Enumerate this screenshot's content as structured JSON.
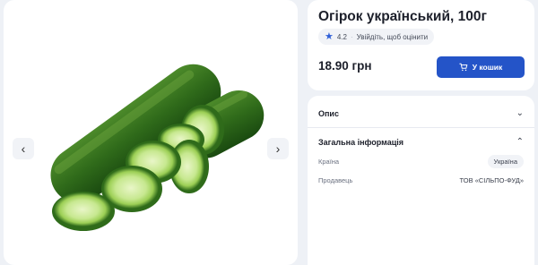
{
  "product": {
    "title": "Огірок український, 100г",
    "rating": "4.2",
    "rate_prompt": "Увійдіть, щоб оцінити",
    "price": "18.90 грн",
    "cart_label": "У кошик"
  },
  "sections": {
    "description": "Опис",
    "general": "Загальна інформація"
  },
  "details": [
    {
      "label": "Країна",
      "value": "Україна"
    },
    {
      "label": "Продавець",
      "value": "ТОВ «СІЛЬПО-ФУД»"
    }
  ],
  "colors": {
    "accent": "#2454c8",
    "star": "#2f5fd7"
  },
  "icons": {
    "prev": "chevron-left-icon",
    "next": "chevron-right-icon",
    "cart": "cart-icon",
    "star": "star-icon"
  }
}
